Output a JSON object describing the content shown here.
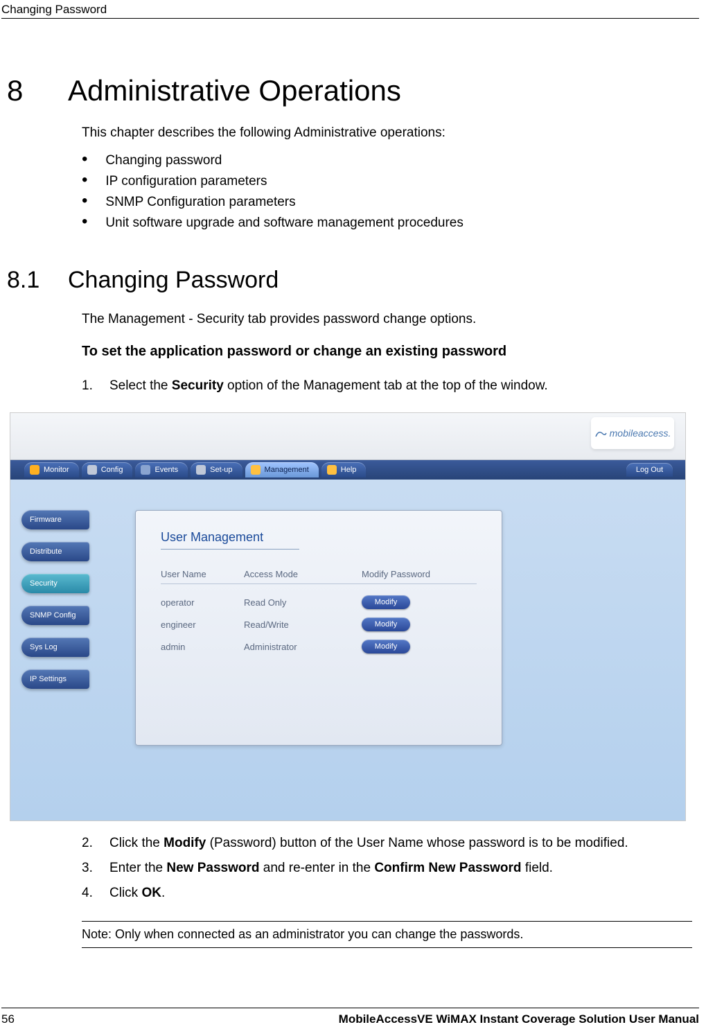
{
  "page_header": "Changing Password",
  "chapter": {
    "num": "8",
    "title": "Administrative Operations"
  },
  "intro": "This chapter describes the following Administrative operations:",
  "bullets": [
    "Changing password",
    "IP configuration parameters",
    "SNMP Configuration parameters",
    "Unit software upgrade and software management procedures"
  ],
  "section": {
    "num": "8.1",
    "title": "Changing Password"
  },
  "section_intro": "The Management - Security tab provides password change options.",
  "procedure_heading": "To set the application password or change an existing password",
  "steps": {
    "s1": {
      "n": "1.",
      "pre": "Select the ",
      "bold": "Security",
      "post": " option of the Management tab at the top of the window."
    },
    "s2": {
      "n": "2.",
      "pre": "Click the ",
      "bold": "Modify",
      "post": " (Password) button of the User Name whose password is to be modified."
    },
    "s3": {
      "n": "3.",
      "pre": "Enter the ",
      "bold1": "New Password",
      "mid": " and re-enter in the ",
      "bold2": "Confirm New Password",
      "post": " field."
    },
    "s4": {
      "n": "4.",
      "pre": "Click ",
      "bold": "OK",
      "post": "."
    }
  },
  "figure": {
    "logo_text": "mobileaccess.",
    "top_tabs": [
      {
        "label": "Monitor"
      },
      {
        "label": "Config"
      },
      {
        "label": "Events"
      },
      {
        "label": "Set-up"
      },
      {
        "label": "Management",
        "active": true
      },
      {
        "label": "Help"
      }
    ],
    "logout": "Log Out",
    "sidebar": [
      {
        "label": "Firmware"
      },
      {
        "label": "Distribute"
      },
      {
        "label": "Security",
        "active": true
      },
      {
        "label": "SNMP Config"
      },
      {
        "label": "Sys Log"
      },
      {
        "label": "IP Settings"
      }
    ],
    "panel_title": "User Management",
    "headers": {
      "user": "User Name",
      "mode": "Access Mode",
      "modify": "Modify Password"
    },
    "rows": [
      {
        "user": "operator",
        "mode": "Read Only",
        "btn": "Modify"
      },
      {
        "user": "engineer",
        "mode": "Read/Write",
        "btn": "Modify"
      },
      {
        "user": "admin",
        "mode": "Administrator",
        "btn": "Modify"
      }
    ]
  },
  "note": "Note: Only when connected as an administrator you can change the passwords.",
  "footer": {
    "page": "56",
    "title": "MobileAccessVE WiMAX Instant Coverage Solution User Manual"
  }
}
